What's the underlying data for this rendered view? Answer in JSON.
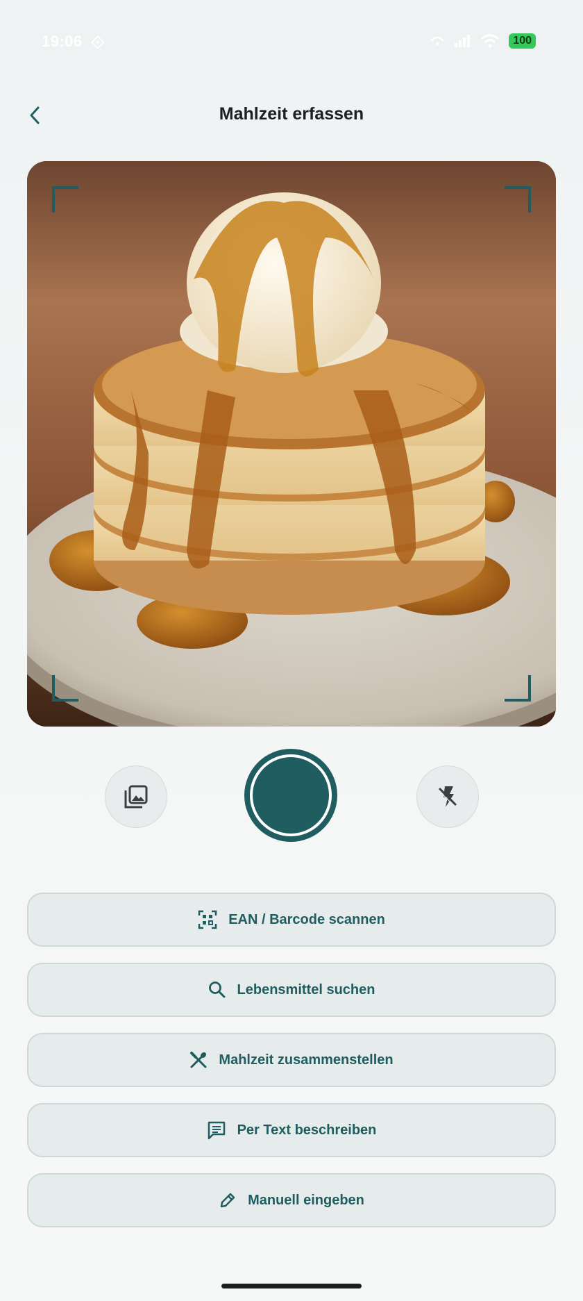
{
  "status_bar": {
    "time": "19:06",
    "battery": "100"
  },
  "header": {
    "title": "Mahlzeit erfassen"
  },
  "camera": {
    "icons": [
      "gallery-icon",
      "shutter",
      "flash-off-icon"
    ]
  },
  "actions": [
    {
      "label": "EAN / Barcode scannen",
      "icon": "barcode-scan-icon"
    },
    {
      "label": "Lebensmittel suchen",
      "icon": "search-icon"
    },
    {
      "label": "Mahlzeit zusammenstellen",
      "icon": "utensils-icon"
    },
    {
      "label": "Per Text beschreiben",
      "icon": "text-message-icon"
    },
    {
      "label": "Manuell eingeben",
      "icon": "pencil-icon"
    }
  ],
  "colors": {
    "accent": "#1f5d60",
    "button_bg": "#e6ebeb",
    "battery": "#34c759"
  }
}
